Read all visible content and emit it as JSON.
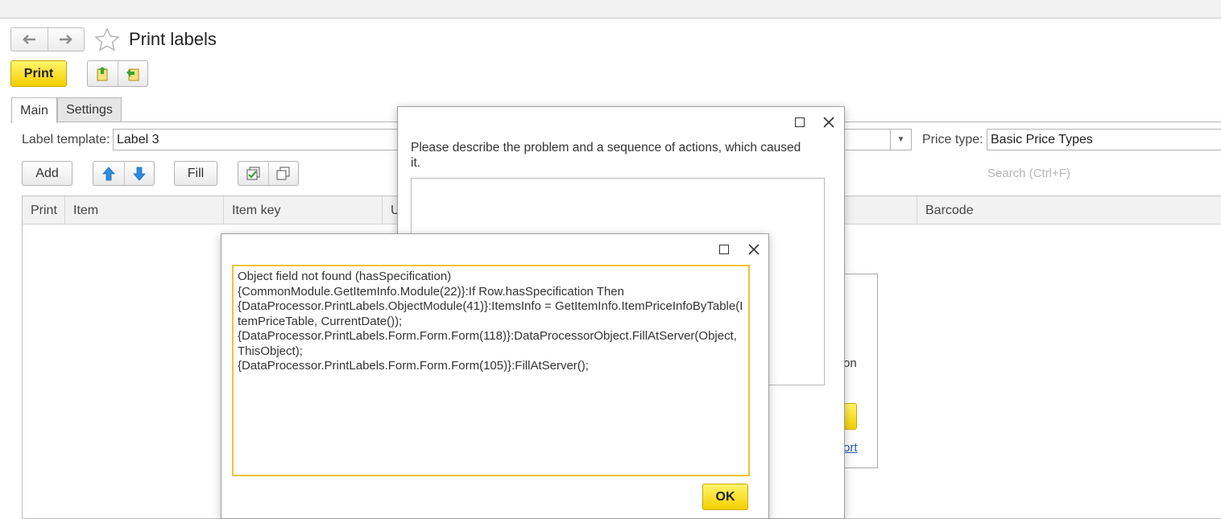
{
  "window": {
    "title": "Print labels",
    "nav_back_icon": "arrow-left-icon",
    "nav_forward_icon": "arrow-right-icon",
    "favorite_icon": "star-icon"
  },
  "toolbar": {
    "print_label": "Print",
    "load_icon": "load-settings-icon",
    "save_icon": "save-settings-icon"
  },
  "tabs": [
    {
      "label": "Main",
      "active": true
    },
    {
      "label": "Settings",
      "active": false
    }
  ],
  "form": {
    "label_template_label": "Label template:",
    "label_template_value": "Label 3",
    "price_type_label": "Price type:",
    "price_type_value": "Basic Price Types"
  },
  "table_toolbar": {
    "add_label": "Add",
    "fill_label": "Fill",
    "search_placeholder": "Search (Ctrl+F)"
  },
  "table": {
    "columns": [
      "Print",
      "Item",
      "Item key",
      "U",
      "Barcode"
    ]
  },
  "report_dialog": {
    "prompt": "Please describe the problem and a sequence of actions, which caused it."
  },
  "behind_dialog": {
    "text_fragment": "on",
    "link_fragment": "ort"
  },
  "error_dialog": {
    "lines": [
      "Object field not found (hasSpecification)",
      "{CommonModule.GetItemInfo.Module(22)}:If Row.hasSpecification Then",
      "{DataProcessor.PrintLabels.ObjectModule(41)}:ItemsInfo = GetItemInfo.ItemPriceInfoByTable(ItemPriceTable, CurrentDate());",
      "{DataProcessor.PrintLabels.Form.Form.Form(118)}:DataProcessorObject.FillAtServer(Object, ThisObject);",
      "{DataProcessor.PrintLabels.Form.Form.Form(105)}:FillAtServer();"
    ],
    "ok_label": "OK"
  },
  "colors": {
    "accent_yellow": "#f4cf00",
    "focus_border": "#f1c232",
    "arrow_blue": "#2a8de0",
    "check_green": "#3aa335"
  }
}
